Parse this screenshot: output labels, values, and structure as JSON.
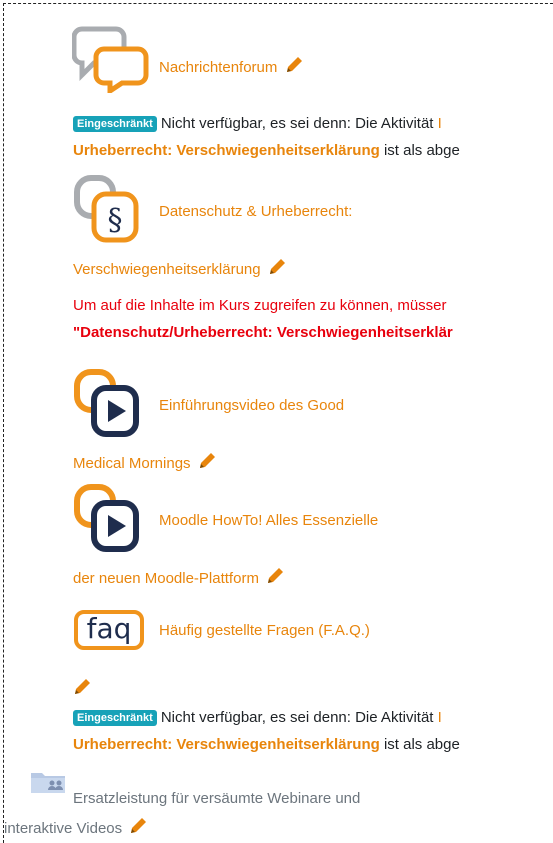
{
  "items": {
    "forum": {
      "label": "Nachrichtenforum"
    },
    "restriction1": {
      "badge": "Eingeschränkt",
      "text": "Nicht verfügbar, es sei denn: Die Aktivität",
      "link_fragment": "I",
      "activity_link": "Urheberrecht: Verschwiegenheitserklärung",
      "suffix": "ist als abge"
    },
    "privacy": {
      "label_line1": "Datenschutz & Urheberrecht:",
      "label_line2": "Verschwiegenheitserklärung"
    },
    "notice": {
      "line1": "Um auf die Inhalte im Kurs zugreifen zu können, müsser",
      "line2": "\"Datenschutz/Urheberrecht: Verschwiegenheitserklär"
    },
    "video1": {
      "label_line1": "Einführungsvideo des Good",
      "label_line2": "Medical Mornings"
    },
    "video2": {
      "label_line1": "Moodle HowTo! Alles Essenzielle",
      "label_line2": "der neuen Moodle-Plattform"
    },
    "faq": {
      "icon_text": "faq",
      "label": "Häufig gestellte Fragen (F.A.Q.)"
    },
    "restriction2": {
      "badge": "Eingeschränkt",
      "text": "Nicht verfügbar, es sei denn: Die Aktivität",
      "link_fragment": "I",
      "activity_link": "Urheberrecht: Verschwiegenheitserklärung",
      "suffix": "ist als abge"
    },
    "folder": {
      "label_line1": "Ersatzleistung für versäumte Webinare und",
      "label_line2": "interaktive Videos"
    }
  },
  "icons": [
    "forum-icon",
    "page-icon",
    "video-icon",
    "faq-icon",
    "folder-icon",
    "pencil-icon"
  ],
  "colors": {
    "accent": "#e8850c",
    "badge": "#17a2b8",
    "warning": "#e8000d",
    "icon_dark": "#1f2d4d",
    "icon_grey": "#9aa0a6"
  }
}
